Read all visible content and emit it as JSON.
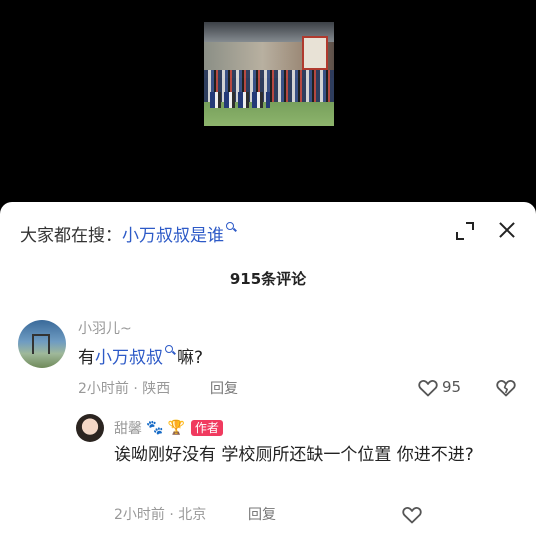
{
  "search": {
    "prefix": "大家都在搜：",
    "term": "小万叔叔是谁"
  },
  "comments_header": {
    "count_label": "915条评论"
  },
  "comments": [
    {
      "username": "小羽儿~",
      "text_before": "有",
      "text_highlight": "小万叔叔",
      "text_after": "嘛?",
      "meta": "2小时前 · 陕西",
      "reply_label": "回复",
      "likes": "95"
    },
    {
      "username": "甜馨",
      "badge": "作者",
      "text": "诶呦刚好没有 学校厕所还缺一个位置 你进不进?",
      "meta": "2小时前 · 北京",
      "reply_label": "回复"
    }
  ],
  "icons": {
    "search": "search-icon",
    "expand": "expand-icon",
    "close": "close-icon",
    "like": "heart-icon",
    "dislike": "broken-heart-icon",
    "paw": "paw-icon",
    "trophy": "trophy-icon"
  },
  "colors": {
    "link": "#2d5ac7",
    "author_badge": "#f03a5f",
    "muted_text": "#999999"
  }
}
